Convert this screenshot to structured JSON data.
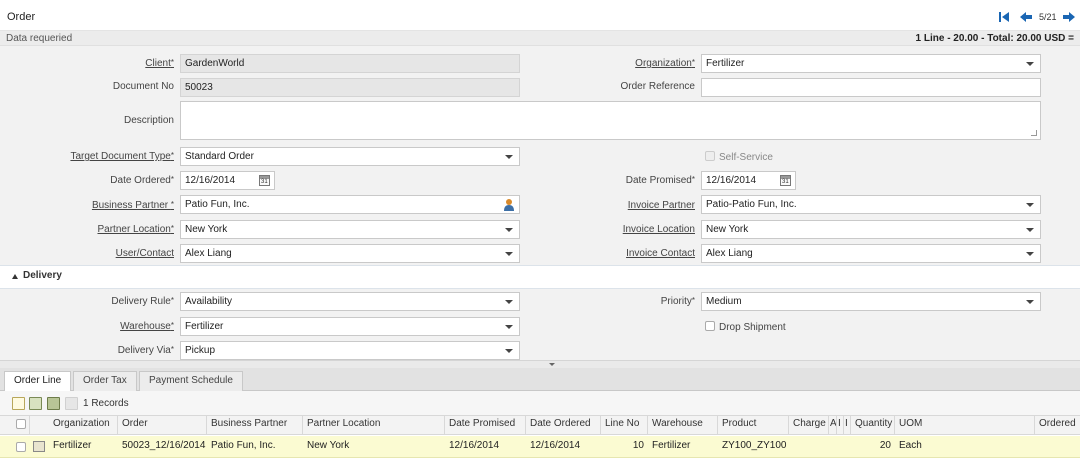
{
  "window": {
    "title": "Order",
    "record_position": "5/21"
  },
  "status": {
    "message": "Data requeried",
    "summary": "1 Line - 20.00 - Total: 20.00 USD ="
  },
  "form": {
    "client": {
      "label": "Client",
      "value": "GardenWorld"
    },
    "organization": {
      "label": "Organization",
      "value": "Fertilizer"
    },
    "document_no": {
      "label": "Document No",
      "value": "50023"
    },
    "order_reference": {
      "label": "Order Reference",
      "value": ""
    },
    "description": {
      "label": "Description",
      "value": ""
    },
    "target_doc_type": {
      "label": "Target Document Type",
      "value": "Standard Order"
    },
    "self_service": {
      "label": "Self-Service",
      "checked": false
    },
    "date_ordered": {
      "label": "Date Ordered",
      "value": "12/16/2014"
    },
    "date_promised": {
      "label": "Date Promised",
      "value": "12/16/2014"
    },
    "business_partner": {
      "label": "Business Partner ",
      "value": "Patio Fun, Inc."
    },
    "invoice_partner": {
      "label": "Invoice Partner",
      "value": "Patio-Patio Fun, Inc."
    },
    "partner_location": {
      "label": "Partner Location",
      "value": "New York"
    },
    "invoice_location": {
      "label": "Invoice Location",
      "value": "New York"
    },
    "user_contact": {
      "label": "User/Contact",
      "value": "Alex Liang"
    },
    "invoice_contact": {
      "label": "Invoice Contact",
      "value": "Alex Liang"
    },
    "calendar_glyph": "31"
  },
  "delivery": {
    "section_title": "Delivery",
    "delivery_rule": {
      "label": "Delivery Rule",
      "value": "Availability"
    },
    "priority": {
      "label": "Priority",
      "value": "Medium"
    },
    "warehouse": {
      "label": "Warehouse",
      "value": "Fertilizer"
    },
    "drop_shipment": {
      "label": "Drop Shipment",
      "checked": false
    },
    "delivery_via": {
      "label": "Delivery Via",
      "value": "Pickup"
    }
  },
  "tabs": [
    {
      "label": "Order Line",
      "active": true
    },
    {
      "label": "Order Tax",
      "active": false
    },
    {
      "label": "Payment Schedule",
      "active": false
    }
  ],
  "toolbar": {
    "records": "1 Records",
    "icons": [
      "new-record-icon",
      "edit-record-icon",
      "delete-record-icon",
      "more-icon"
    ]
  },
  "grid": {
    "columns": [
      "Organization",
      "Order",
      "Business Partner",
      "Partner Location",
      "Date Promised",
      "Date Ordered",
      "Line No",
      "Warehouse",
      "Product",
      "Charge",
      "A",
      "I",
      "I",
      "Quantity",
      "UOM",
      "Ordered"
    ],
    "rows": [
      {
        "cells": [
          "Fertilizer",
          "50023_12/16/2014",
          "Patio Fun, Inc.",
          "New York",
          "12/16/2014",
          "12/16/2014",
          "10",
          "Fertilizer",
          "ZY100_ZY100",
          "",
          "",
          "",
          "",
          "20",
          "Each",
          ""
        ]
      }
    ]
  },
  "colors": {
    "accent": "#1a66b3",
    "selected_row": "#fbfbd2",
    "form_bg": "#f2f2f2"
  }
}
